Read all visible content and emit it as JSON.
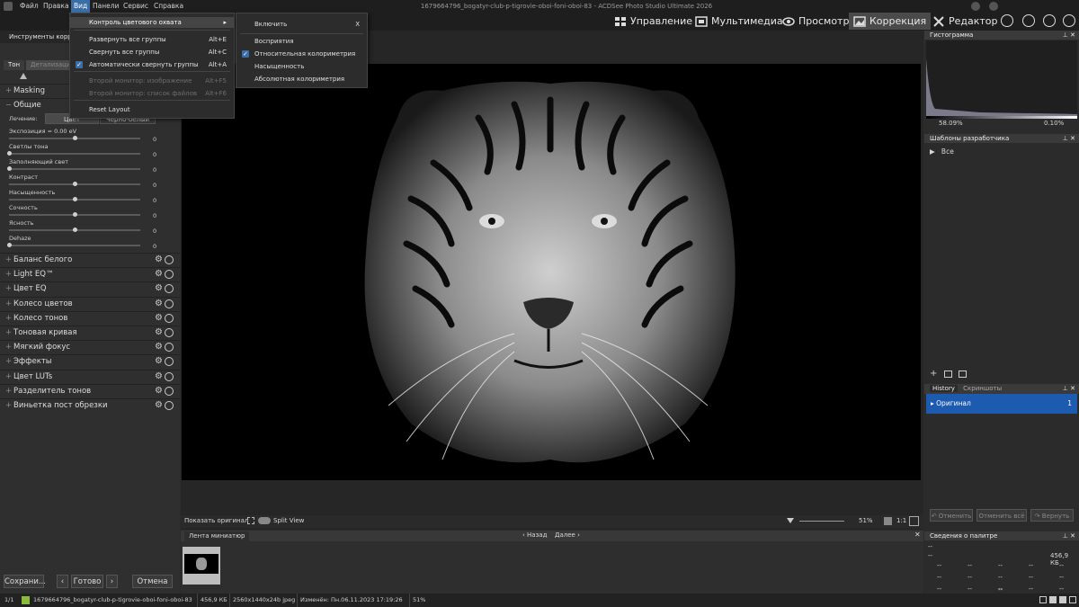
{
  "window": {
    "title": "1679664796_bogatyr-club-p-tigrovie-oboi-foni-oboi-83 - ACDSee Photo Studio Ultimate 2026"
  },
  "menubar": [
    "Файл",
    "Правка",
    "Вид",
    "Панели",
    "Сервис",
    "Справка"
  ],
  "modes": [
    {
      "label": "Управление",
      "icon": "grid-icon"
    },
    {
      "label": "Мультимедиа",
      "icon": "film-icon"
    },
    {
      "label": "Просмотр",
      "icon": "eye-icon"
    },
    {
      "label": "Коррекция",
      "icon": "image-icon"
    },
    {
      "label": "Редактор",
      "icon": "tools-icon"
    }
  ],
  "view_menu": {
    "items": [
      {
        "label": "Контроль цветового охвата",
        "shortcut": "",
        "state": "highlighted"
      },
      {
        "label": "Развернуть все группы",
        "shortcut": "Alt+E",
        "state": "normal"
      },
      {
        "label": "Свернуть все группы",
        "shortcut": "Alt+C",
        "state": "normal"
      },
      {
        "label": "Автоматически свернуть группы",
        "shortcut": "Alt+A",
        "state": "checked"
      },
      {
        "label": "Второй монитор: изображение",
        "shortcut": "Alt+F5",
        "state": "disabled"
      },
      {
        "label": "Второй монитор: список файлов",
        "shortcut": "Alt+F6",
        "state": "disabled"
      },
      {
        "label": "Reset Layout",
        "shortcut": "",
        "state": "normal"
      }
    ]
  },
  "gamut_submenu": {
    "enable_label": "Включить",
    "enable_shortcut": "X",
    "options": [
      {
        "label": "Восприятия",
        "checked": false
      },
      {
        "label": "Относительная колориметрия",
        "checked": true
      },
      {
        "label": "Насыщенность",
        "checked": false
      },
      {
        "label": "Абсолютная колориметрия",
        "checked": false
      }
    ]
  },
  "left_panel": {
    "header": "Инструменты корре",
    "tabs": [
      "Тон",
      "Детализация"
    ],
    "masking": "Masking",
    "general": "Общие",
    "treatment_label": "Лечение:",
    "treatment_options": [
      "Цвет",
      "Черно-белый"
    ],
    "sliders": [
      {
        "label": "Экспозиция = 0.00 eV",
        "value": "",
        "knob": 0.5
      },
      {
        "label": "Светлы тона",
        "value": "0",
        "knob": 0
      },
      {
        "label": "Заполняющий свет",
        "value": "0",
        "knob": 0
      },
      {
        "label": "Контраст",
        "value": "0",
        "knob": 0.5
      },
      {
        "label": "Насыщенность",
        "value": "0",
        "knob": 0.5
      },
      {
        "label": "Сочность",
        "value": "0",
        "knob": 0.5
      },
      {
        "label": "Ясность",
        "value": "0",
        "knob": 0.5
      },
      {
        "label": "Dehaze",
        "value": "0",
        "knob": 0
      }
    ],
    "first_value": "0",
    "groups": [
      "Баланс белого",
      "Light EQ™",
      "Цвет EQ",
      "Колесо цветов",
      "Колесо тонов",
      "Тоновая кривая",
      "Мягкий фокус",
      "Эффекты",
      "Цвет LUTs",
      "Разделитель тонов",
      "Виньетка пост обрезки"
    ],
    "buttons": {
      "save": "Сохрани...",
      "done": "Готово",
      "cancel": "Отмена"
    }
  },
  "photo_bar": {
    "show_original": "Показать оригинал",
    "split_view": "Split View",
    "zoom": "51%",
    "ratio": "1:1"
  },
  "filmstrip": {
    "title": "Лента миниатюр",
    "back": "Назад",
    "forward": "Далее"
  },
  "right_panel": {
    "histogram_title": "Гистограмма",
    "hist_left": "58.09%",
    "hist_right": "0.10%",
    "presets_title": "Шаблоны разработчика",
    "presets_item": "Все",
    "history_tab": "History",
    "screenshots_tab": "Скриншоты",
    "history_item": "Оригинал",
    "history_count": "1",
    "undo": "Отменить",
    "undo_all": "Отменить всё",
    "redo": "Вернуть",
    "palette_title": "Сведения о палитре",
    "palette_size": "456,9 КБ",
    "dash": "--"
  },
  "status": {
    "count": "1/1",
    "filename": "1679664796_bogatyr-club-p-tigrovie-oboi-foni-oboi-83",
    "size": "456,9 КБ",
    "dims": "2560x1440x24b jpeg",
    "modified": "Изменён: Пн.06.11.2023 17:19:26",
    "zoom": "51%"
  }
}
